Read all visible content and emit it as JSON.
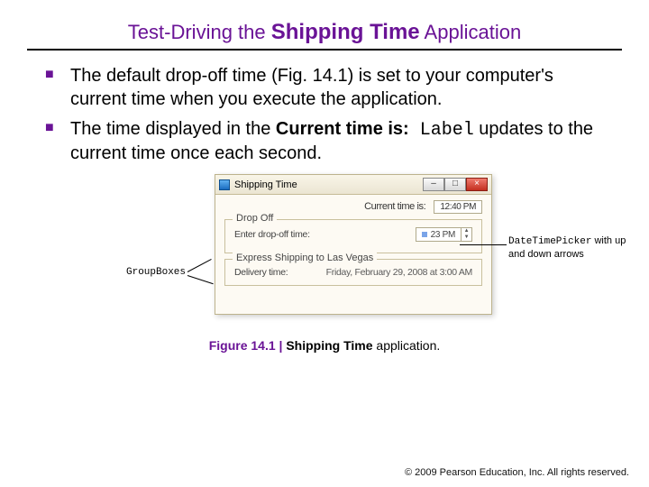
{
  "title": {
    "prefix": "Test-Driving the ",
    "bold": "Shipping Time",
    "suffix": " Application"
  },
  "bullets": [
    {
      "text_a": "The default drop-off time (Fig. 14.1) is set to your computer's current time when you execute the application."
    },
    {
      "text_b_pre": "The time displayed in the ",
      "text_b_bold": "Current time is:",
      "text_b_mono": " Label",
      "text_b_post": " updates to the current time once each second."
    }
  ],
  "window": {
    "title": "Shipping Time",
    "current_time_label": "Current time is:",
    "current_time_value": "12:40 PM",
    "group1": {
      "legend": "Drop Off",
      "label": "Enter drop-off time:",
      "picker_value": "23 PM"
    },
    "group2": {
      "legend": "Express Shipping to Las Vegas",
      "label": "Delivery time:",
      "value": "Friday, February 29, 2008 at 3:00 AM"
    },
    "buttons": {
      "minimize": "–",
      "maximize": "□",
      "close": "×"
    }
  },
  "callouts": {
    "left": "GroupBoxes",
    "right_mono": "DateTimePicker",
    "right_rest": " with up and down arrows"
  },
  "caption": {
    "figlabel": "Figure 14.1",
    "bar": " | ",
    "bold": "Shipping Time",
    "suffix": " application."
  },
  "footer": {
    "copy": "©",
    "text": " 2009 Pearson Education, Inc. All rights reserved."
  }
}
